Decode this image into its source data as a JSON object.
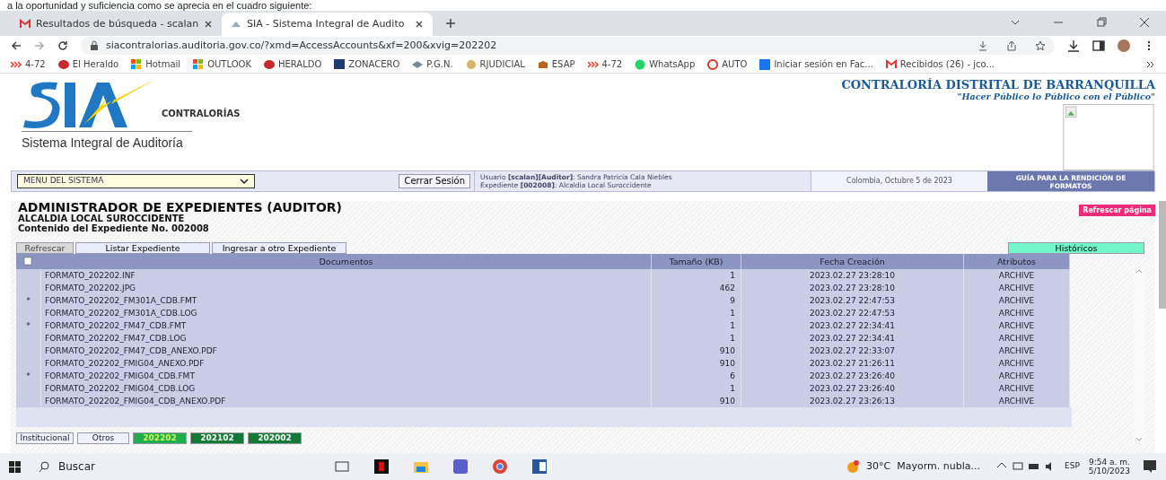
{
  "doc_text": "a la oportunidad y suficiencia como se aprecia en el cuadro siguiente:",
  "browser": {
    "tabs": [
      {
        "label": "Resultados de búsqueda - scalan",
        "selected": false
      },
      {
        "label": "SIA - Sistema Integral de Audito",
        "selected": true
      }
    ],
    "address": "siacontralorias.auditoria.gov.co/?xmd=AccessAccounts&xf=200&xvig=202202",
    "bookmarks": [
      "4-72",
      "El Heraldo",
      "Hotmail",
      "OUTLOOK",
      "HERALDO",
      "ZONACERO",
      "P.G.N.",
      "RJUDICIAL",
      "ESAP",
      "4-72",
      "WhatsApp",
      "AUTO",
      "Iniciar sesión en Fac...",
      "Recibidos (26) - jco..."
    ]
  },
  "header": {
    "logo_word": "CONTRALORÍAS",
    "logo_subtitle": "Sistema Integral de Auditoría",
    "org": "CONTRALORÍA DISTRITAL DE BARRANQUILLA",
    "motto": "\"Hacer Público lo Público con el Público\""
  },
  "menu_bar": {
    "menu": "MENU DEL SISTEMA",
    "logout": "Cerrar Sesión",
    "user_line": "Usuario **[scalan][Auditor]**: Sandra Patricia Cala Niebles",
    "case_line": "Expediente **[002008]**: Alcaldia Local Suroccidente",
    "date": "Colombia, Octubre 5 de 2023",
    "guide": "GUÍA PARA LA RENDICIÓN DE FORMATOS"
  },
  "title": "ADMINISTRADOR DE EXPEDIENTES (AUDITOR)",
  "subtitle": "ALCALDIA LOCAL SUROCCIDENTE",
  "content_line": "Contenido del Expediente No. 002008",
  "refresh_page": "Refrescar página",
  "actions": [
    {
      "label": "Refrescar",
      "selected": true
    },
    {
      "label": "Listar Expediente",
      "selected": false
    },
    {
      "label": "Ingresar a otro Expediente",
      "selected": false
    }
  ],
  "history": "Históricos",
  "table": {
    "columns": [
      "Documentos",
      "Tamaño (KB)",
      "Fecha Creación",
      "Atributos"
    ],
    "rows": [
      {
        "mark": "",
        "name": "FORMATO_202202.INF",
        "size": "1",
        "date": "2023.02.27 23:28:10",
        "attr": "ARCHIVE"
      },
      {
        "mark": "",
        "name": "FORMATO_202202.JPG",
        "size": "462",
        "date": "2023.02.27 23:28:10",
        "attr": "ARCHIVE"
      },
      {
        "mark": "*",
        "name": "FORMATO_202202_FM301A_CDB.FMT",
        "size": "9",
        "date": "2023.02.27 22:47:53",
        "attr": "ARCHIVE"
      },
      {
        "mark": "",
        "name": "FORMATO_202202_FM301A_CDB.LOG",
        "size": "1",
        "date": "2023.02.27 22:47:53",
        "attr": "ARCHIVE"
      },
      {
        "mark": "*",
        "name": "FORMATO_202202_FM47_CDB.FMT",
        "size": "1",
        "date": "2023.02.27 22:34:41",
        "attr": "ARCHIVE"
      },
      {
        "mark": "",
        "name": "FORMATO_202202_FM47_CDB.LOG",
        "size": "1",
        "date": "2023.02.27 22:34:41",
        "attr": "ARCHIVE"
      },
      {
        "mark": "",
        "name": "FORMATO_202202_FM47_CDB_ANEXO.PDF",
        "size": "910",
        "date": "2023.02.27 22:33:07",
        "attr": "ARCHIVE"
      },
      {
        "mark": "",
        "name": "FORMATO_202202_FMIG04_ANEXO.PDF",
        "size": "910",
        "date": "2023.02.27 21:26:11",
        "attr": "ARCHIVE"
      },
      {
        "mark": "*",
        "name": "FORMATO_202202_FMIG04_CDB.FMT",
        "size": "6",
        "date": "2023.02.27 23:26:40",
        "attr": "ARCHIVE"
      },
      {
        "mark": "",
        "name": "FORMATO_202202_FMIG04_CDB.LOG",
        "size": "1",
        "date": "2023.02.27 23:26:40",
        "attr": "ARCHIVE"
      },
      {
        "mark": "",
        "name": "FORMATO_202202_FMIG04_CDB_ANEXO.PDF",
        "size": "910",
        "date": "2023.02.27 23:26:13",
        "attr": "ARCHIVE"
      }
    ]
  },
  "bottom_tabs": [
    {
      "label": "Institucional",
      "kind": "plain",
      "selected": false
    },
    {
      "label": "Otros",
      "kind": "plain",
      "selected": false
    },
    {
      "label": "202202",
      "kind": "year",
      "selected": true
    },
    {
      "label": "202102",
      "kind": "year",
      "selected": false
    },
    {
      "label": "202002",
      "kind": "year",
      "selected": false
    }
  ],
  "taskbar": {
    "search": "Buscar",
    "weather": "30°C  Mayorm. nubla...",
    "language": "ESP",
    "time": "9:54 a. m.",
    "date": "5/10/2023"
  }
}
